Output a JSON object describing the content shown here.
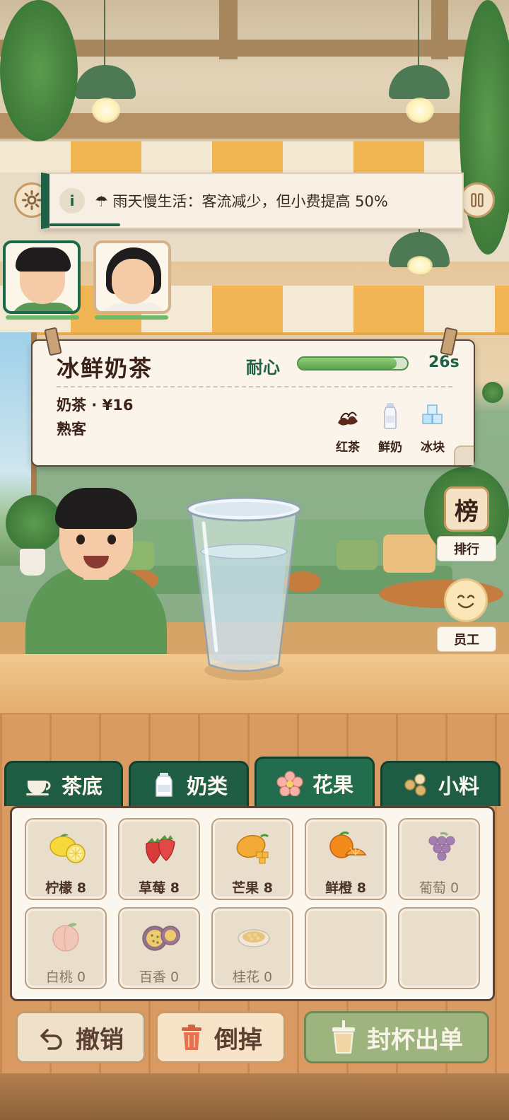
{
  "hud": {
    "settings_icon": "gear-icon",
    "pause_icon": "pause-icon",
    "notice": {
      "icon": "info-icon",
      "info_letter": "i",
      "text": "☂ 雨天慢生活：客流减少，但小费提高 50%"
    }
  },
  "customers_queue": [
    {
      "portrait": "boy-green-hoodie",
      "active": true,
      "patience": 0.95
    },
    {
      "portrait": "girl-bob-hair",
      "active": false,
      "patience": 0.95
    }
  ],
  "order": {
    "drink_name": "冰鲜奶茶",
    "patience_label": "耐心",
    "patience_fraction": 0.9,
    "time_left": "26s",
    "category_price": "奶茶 · ¥16",
    "customer_type": "熟客",
    "ingredients": [
      {
        "label": "红茶",
        "icon": "black-tea-leaves-icon"
      },
      {
        "label": "鲜奶",
        "icon": "milk-bottle-icon"
      },
      {
        "label": "冰块",
        "icon": "ice-cubes-icon"
      }
    ]
  },
  "side_menu": {
    "leaderboard_glyph": "榜",
    "leaderboard_label": "排行",
    "staff_label": "员工"
  },
  "tabs": [
    {
      "label": "茶底",
      "icon": "teacup-icon",
      "active": false
    },
    {
      "label": "奶类",
      "icon": "milk-carton-icon",
      "active": false
    },
    {
      "label": "花果",
      "icon": "flower-icon",
      "active": true
    },
    {
      "label": "小料",
      "icon": "toppings-icon",
      "active": false
    }
  ],
  "ingredients_panel": [
    {
      "label": "柠檬 8",
      "icon": "lemon-icon",
      "stock": 8
    },
    {
      "label": "草莓 8",
      "icon": "strawberry-icon",
      "stock": 8
    },
    {
      "label": "芒果 8",
      "icon": "mango-icon",
      "stock": 8
    },
    {
      "label": "鲜橙 8",
      "icon": "orange-icon",
      "stock": 8
    },
    {
      "label": "葡萄 0",
      "icon": "grape-icon",
      "stock": 0
    },
    {
      "label": "白桃 0",
      "icon": "peach-icon",
      "stock": 0
    },
    {
      "label": "百香 0",
      "icon": "passionfruit-icon",
      "stock": 0
    },
    {
      "label": "桂花 0",
      "icon": "osmanthus-icon",
      "stock": 0
    },
    {
      "label": "",
      "icon": "",
      "stock": null
    },
    {
      "label": "",
      "icon": "",
      "stock": null
    }
  ],
  "actions": {
    "undo": "撤销",
    "dump": "倒掉",
    "seal": "封杯出单"
  },
  "colors": {
    "primary_green": "#1e5d44",
    "accent_orange": "#f0b653",
    "card_bg": "#fbf4ea",
    "text_brown": "#3a2218"
  }
}
